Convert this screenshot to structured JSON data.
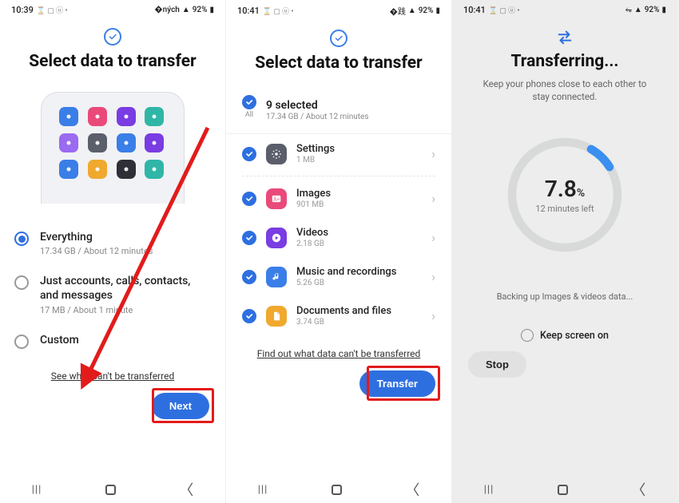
{
  "status": {
    "time1": "10:39",
    "time2": "10:41",
    "time3": "10:41",
    "icons_left": "⌛ 🖼 🇺 •",
    "signal": "📶",
    "battery_pct": "92%",
    "battery_icon": "▮"
  },
  "screen1": {
    "title": "Select data to transfer",
    "options": [
      {
        "label": "Everything",
        "sub": "17.34 GB / About 12 minutes",
        "selected": true
      },
      {
        "label": "Just accounts, calls, contacts, and messages",
        "sub": "17 MB / About 1 minute",
        "selected": false
      },
      {
        "label": "Custom",
        "sub": "",
        "selected": false
      }
    ],
    "link": "See what can't be transferred",
    "button": "Next"
  },
  "screen2": {
    "title": "Select data to transfer",
    "all": {
      "count_label": "9 selected",
      "sub": "17.34 GB / About 12 minutes",
      "all_tag": "All"
    },
    "categories": [
      {
        "name": "Settings",
        "size": "1 MB",
        "color": "#5b5e6b",
        "glyph": "gear"
      },
      {
        "name": "Images",
        "size": "901 MB",
        "color": "#ea4a7a",
        "glyph": "image"
      },
      {
        "name": "Videos",
        "size": "2.18 GB",
        "color": "#7a3ce3",
        "glyph": "play"
      },
      {
        "name": "Music and recordings",
        "size": "5.26 GB",
        "color": "#3a7ee8",
        "glyph": "note"
      },
      {
        "name": "Documents and files",
        "size": "3.74 GB",
        "color": "#f0a92e",
        "glyph": "doc"
      }
    ],
    "link": "Find out what data can't be transferred",
    "button": "Transfer"
  },
  "screen3": {
    "title": "Transferring...",
    "subtitle": "Keep your phones close to each other to stay connected.",
    "progress_pct": 7.8,
    "progress_pct_label": "7.8",
    "progress_pct_suffix": "%",
    "time_left": "12 minutes left",
    "status": "Backing up Images & videos data...",
    "keep_screen": "Keep screen on",
    "stop": "Stop"
  },
  "illus_colors": [
    "#3a7ee8",
    "#ea4a7a",
    "#7a3ce3",
    "#2fb6a7",
    "#9a6af0",
    "#5b5e6b",
    "#3a7ee8",
    "#7a3ce3",
    "#3a7ee8",
    "#f0a92e",
    "#2f2f38",
    "#2fb6a7"
  ]
}
